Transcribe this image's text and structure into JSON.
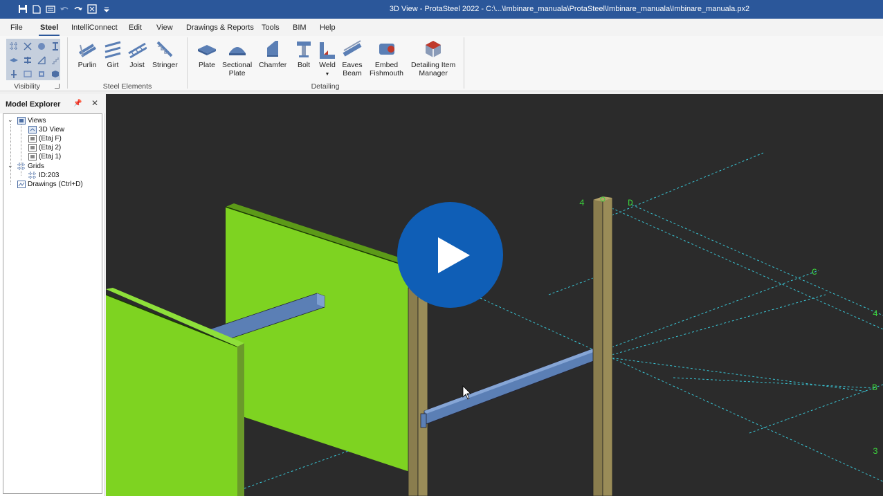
{
  "title": "3D View - ProtaSteel 2022 - C:\\...\\Imbinare_manuala\\ProtaSteel\\Imbinare_manuala\\Imbinare_manuala.px2",
  "quick_access": [
    "save-icon",
    "new-file-icon",
    "open-file-icon",
    "undo-icon",
    "redo-icon",
    "fullscreen-icon",
    "customize-icon"
  ],
  "menu": {
    "file": "File",
    "steel": "Steel",
    "intelliconnect": "IntelliConnect",
    "edit": "Edit",
    "view": "View",
    "drawings": "Drawings & Reports",
    "tools": "Tools",
    "bim": "BIM",
    "help": "Help"
  },
  "ribbon": {
    "visibility_label": "Visibility",
    "steel_elements_label": "Steel Elements",
    "detailing_label": "Detailing",
    "purlin": "Purlin",
    "girt": "Girt",
    "joist": "Joist",
    "stringer": "Stringer",
    "plate": "Plate",
    "sectional_plate_1": "Sectional",
    "sectional_plate_2": "Plate",
    "chamfer": "Chamfer",
    "bolt": "Bolt",
    "weld": "Weld",
    "eaves_beam_1": "Eaves",
    "eaves_beam_2": "Beam",
    "embed_1": "Embed",
    "embed_2": "Fishmouth",
    "detailing_item_1": "Detailing Item",
    "detailing_item_2": "Manager"
  },
  "explorer": {
    "title": "Model Explorer",
    "views": "Views",
    "view_3d": "3D View",
    "etaj_f": "(Etaj F)",
    "etaj_2": "(Etaj 2)",
    "etaj_1": "(Etaj 1)",
    "grids": "Grids",
    "grid_id": "ID:203",
    "drawings": "Drawings (Ctrl+D)"
  },
  "viewport": {
    "grid_labels": {
      "4a": "4",
      "d": "D",
      "c": "C",
      "4b": "4",
      "b": "B",
      "3": "3"
    }
  },
  "colors": {
    "titlebar": "#2b579a",
    "viewport_bg": "#2b2b2b",
    "panel_green": "#7ed321",
    "column_olive": "#8a7d4e",
    "beam_blue": "#5b7fb5",
    "grid_cyan": "#39c6d6",
    "grid_label_green": "#3cd13c",
    "play_button": "#0f5eb6"
  }
}
